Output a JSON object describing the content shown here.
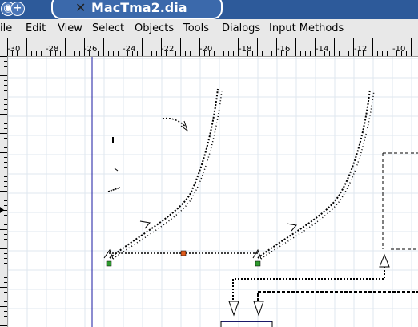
{
  "window": {
    "title": "MacTma2.dia",
    "app_icon": "dia-icon",
    "left_button_glyph": "◉",
    "right_button_glyph": "+"
  },
  "menu": [
    "ile",
    "Edit",
    "View",
    "Select",
    "Objects",
    "Tools",
    "Dialogs",
    "Input Methods"
  ],
  "ruler": {
    "labels": [
      "-30",
      "-28",
      "-26",
      "-24",
      "-22",
      "-20",
      "-18",
      "-16",
      "-14",
      "-12",
      "-10"
    ]
  },
  "colors": {
    "titlebar": "#2d5a9a",
    "grid": "#dfe7ef",
    "guide": "#1a1aa0",
    "handle_green": "#2e9a2e",
    "handle_orange": "#e05a1a"
  }
}
